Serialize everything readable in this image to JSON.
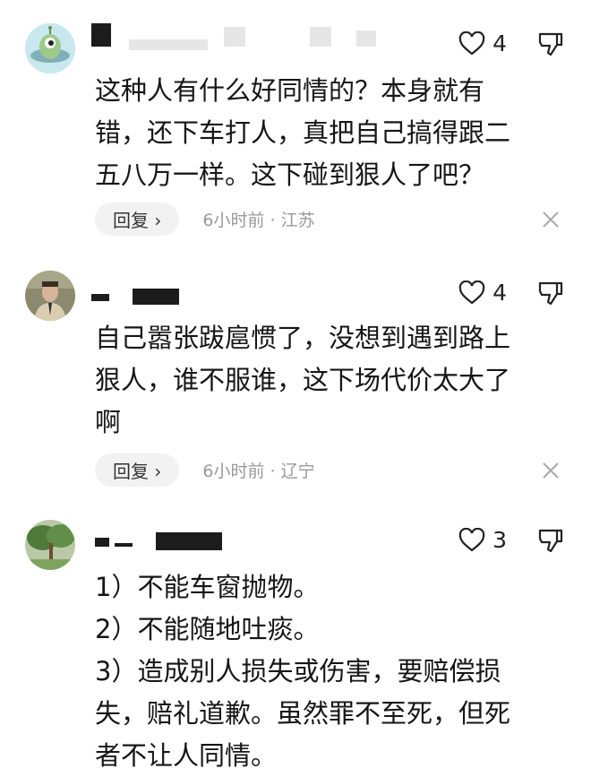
{
  "comments": [
    {
      "likes": "4",
      "lines": [
        "这种人有什么好同情的？本身就有",
        "错，还下车打人，真把自己搞得跟二",
        "五八万一样。这下碰到狠人了吧？"
      ],
      "reply_label": "回复 ›",
      "meta": "6小时前 · 江苏"
    },
    {
      "likes": "4",
      "lines": [
        "自己嚣张跋扈惯了，没想到遇到路上",
        "狠人，谁不服谁，这下场代价太大了",
        "啊"
      ],
      "reply_label": "回复 ›",
      "meta": "6小时前 · 辽宁"
    },
    {
      "likes": "3",
      "lines": [
        "1）不能车窗抛物。",
        "2）不能随地吐痰。",
        "3）造成别人损失或伤害，要赔偿损",
        "失，赔礼道歉。虽然罪不至死，但死",
        "者不让人同情。"
      ]
    }
  ],
  "icons": {
    "like": "heart-outline-icon",
    "dislike": "thumb-down-icon",
    "close": "close-icon"
  }
}
